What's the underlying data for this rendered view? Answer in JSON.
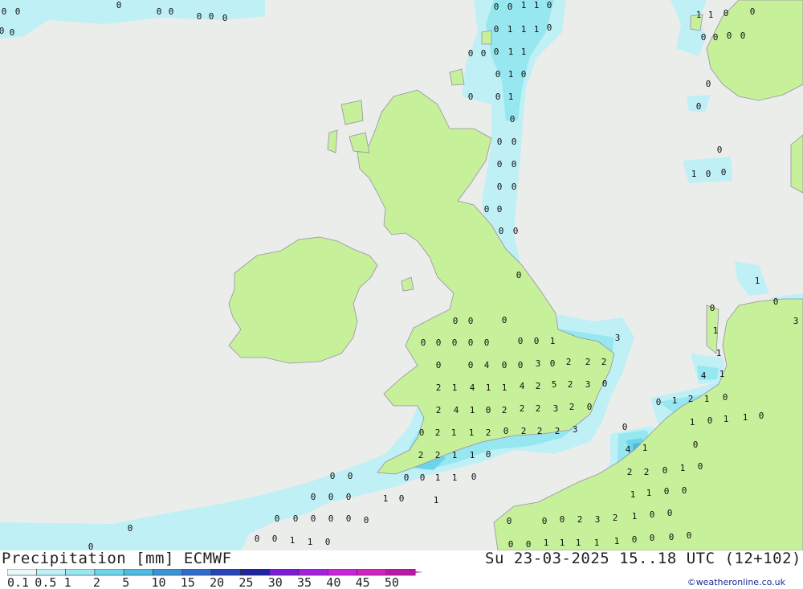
{
  "header": {
    "title": "Precipitation [mm] ECMWF",
    "run": "Su 23-03-2025 15..18 UTC (12+102)",
    "credit": "©weatheronline.co.uk"
  },
  "legend": {
    "labels": [
      "0.1",
      "0.5",
      "1",
      "2",
      "5",
      "10",
      "15",
      "20",
      "25",
      "30",
      "35",
      "40",
      "45",
      "50"
    ],
    "colors": [
      "#e9f8fb",
      "#bff0f6",
      "#96e7f0",
      "#6dd5ea",
      "#4ebbe1",
      "#3a95d6",
      "#2f6bcc",
      "#2643b8",
      "#1d25a0",
      "#7c1bd8",
      "#a91ee0",
      "#cc22dd",
      "#d421c4",
      "#bd17a8"
    ]
  },
  "map_colors": {
    "sea": "#ebedeb",
    "land": "#c6f09a",
    "precip_light": "#bff0f6",
    "precip_mid": "#96e7f0",
    "precip_heavy": "#6dd5ea",
    "precip_max": "#4ebbe1"
  },
  "values": [
    "0",
    "1",
    "2",
    "3",
    "4",
    "5"
  ]
}
